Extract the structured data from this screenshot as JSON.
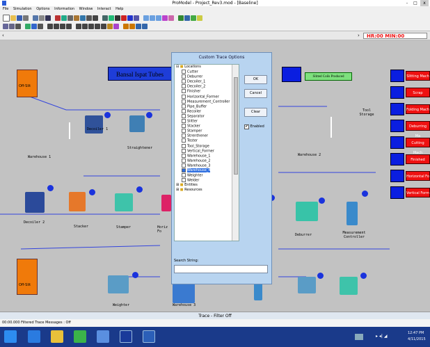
{
  "window": {
    "title": "ProModel - Project_Rev3.mod - [Baseline]",
    "controls": [
      "-",
      "□",
      "x"
    ]
  },
  "menu": [
    "File",
    "Simulation",
    "Options",
    "Information",
    "Window",
    "Interact",
    "Help"
  ],
  "clock": "HR:00 MIN:00",
  "canvas": {
    "banner": "Bansal Ispat Tubes",
    "slitted_coils": "Slitted Coils Produced",
    "offslit_top": "Off-Slit",
    "offslit_bottom": "Off-Slit",
    "decoiler1": "Decoiler 1",
    "straightener": "Straightener",
    "warehouse1": "Warehouse 1",
    "warehouse2": "Warehouse 2",
    "tool_storage": "Tool Storage",
    "decoiler2": "Decoiler 2",
    "stacker": "Stacker",
    "stamper": "Stamper",
    "horiz_former": "Horiz Fo",
    "deburrer": "Deburrer",
    "measurement": "Measurement Controller",
    "weighter": "Weighter",
    "warehouse3": "Warehouse 3",
    "right_labels": [
      "Slitting Mach",
      "Scrap",
      "Folding Mach",
      "Deburring Ma",
      "Cutting Mach",
      "Finished",
      "Horizontal Fo",
      "Vertical Form"
    ]
  },
  "dialog": {
    "title": "Custom Trace Options",
    "root": "Locations",
    "items": [
      "Cutter",
      "Deburrer",
      "Decoiler_1",
      "Decoiler_2",
      "Finisher",
      "Horizontal_Former",
      "Measurement_Controller",
      "Pipe_Buffer",
      "Recoiler",
      "Separator",
      "Slitter",
      "Stacker",
      "Stamper",
      "Strenthener",
      "Tester",
      "Tool_Storage",
      "Vertical_Former",
      "Warehouse_1",
      "Warehouse_2",
      "Warehouse_3",
      "Warehouse_4",
      "Weighter",
      "Welder"
    ],
    "selected_index": 20,
    "groups": [
      "Entities",
      "Resources"
    ],
    "ok": "OK",
    "cancel": "Cancel",
    "clear": "Clear",
    "enabled": "Enabled",
    "search_label": "Search String:"
  },
  "trace_bar": "Trace - Filter Off",
  "status": "00:00.000 Filtered Trace Messages : Off",
  "taskbar": {
    "time": "12:47 PM",
    "date": "4/11/2015"
  },
  "colors": {
    "accent_red": "#e11111",
    "accent_blue": "#0a1ee0",
    "orange": "#f07a0a",
    "canvas": "#c2c2c2"
  }
}
